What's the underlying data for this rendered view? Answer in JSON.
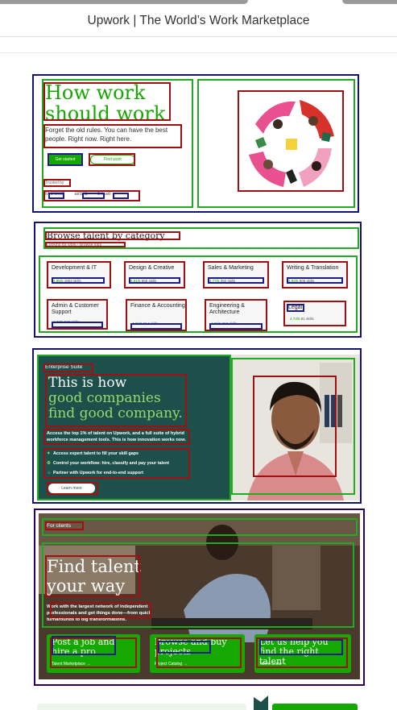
{
  "window": {
    "title": "Upwork | The World’s Work Marketplace"
  },
  "hero": {
    "title": "How work should work",
    "subtitle": "Forget the old rules. You can have the best people. Right now. Right here.",
    "get_started": "Get started",
    "find_work": "Find work",
    "trusted_by": "Trusted by",
    "logos": [
      "Microsoft",
      "airbnb",
      "bissell"
    ]
  },
  "categories": {
    "title": "Browse talent by category",
    "subtitle": "Looking for work? Browse jobs",
    "items": [
      {
        "name": "Development & IT",
        "rating": "4.85/5",
        "skills": "1853 skills"
      },
      {
        "name": "Design & Creative",
        "rating": "4.91/5",
        "skills": "968 skills"
      },
      {
        "name": "Sales & Marketing",
        "rating": "4.77/5",
        "skills": "392 skills"
      },
      {
        "name": "Writing & Translation",
        "rating": "4.92/5",
        "skills": "505 skills"
      },
      {
        "name": "Admin & Customer Support",
        "rating": "4.77/5",
        "skills": "508 skills"
      },
      {
        "name": "Finance & Accounting",
        "rating": "4.79/5",
        "skills": "214 skills"
      },
      {
        "name": "Engineering & Architecture",
        "rating": "4.85/5",
        "skills": "650 skills"
      },
      {
        "name": "Legal",
        "rating": "4.73/5",
        "skills": "61 skills"
      }
    ]
  },
  "enterprise": {
    "tag": "Enterprise Suite",
    "title_line1": "This is how",
    "title_line2": "good companies",
    "title_line3": "find good company.",
    "description": "Access the top 1% of talent on Upwork, and a full suite of hybrid workforce management tools. This is how innovation works now.",
    "bullets": [
      "Access expert talent to fill your skill gaps",
      "Control your workflow: hire, classify and pay your talent",
      "Partner with Upwork for end-to-end support"
    ],
    "cta": "Learn more"
  },
  "clients": {
    "tag": "For clients",
    "title": "Find talent your way",
    "description": "Work with the largest network of independent professionals and get things done—from quick turnarounds to big transformations.",
    "tiles": [
      {
        "title": "Post a job and hire a pro",
        "link": "Talent Marketplace →"
      },
      {
        "title": "Browse and buy projects",
        "link": "Project Catalog →"
      },
      {
        "title": "Let us help you find the right talent",
        "link": "Talent Scout →"
      }
    ]
  },
  "colors": {
    "brand_green": "#14a800",
    "enterprise_bg": "#1d4f4b",
    "accent_green": "#9bd76b"
  }
}
